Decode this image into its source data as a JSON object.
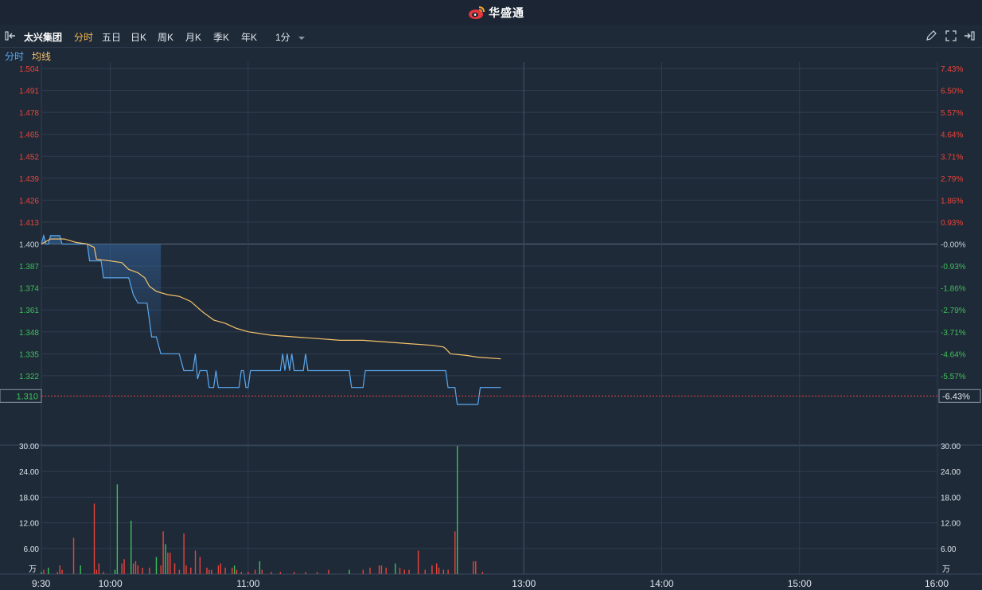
{
  "header": {
    "brand": "华盛通",
    "brand_color": "#e8383d"
  },
  "toolbar": {
    "stock_name": "太兴集团",
    "tabs": [
      "分时",
      "五日",
      "日K",
      "周K",
      "月K",
      "季K",
      "年K"
    ],
    "active_tab": "分时",
    "interval": "1分",
    "icons": [
      "draw-pen-icon",
      "fullscreen-icon",
      "collapse-right-icon"
    ]
  },
  "legend": {
    "price_label": "分时",
    "avg_label": "均线",
    "price_color": "#5aa9f0",
    "avg_color": "#f5c26b"
  },
  "colors": {
    "up": "#e8443a",
    "down": "#3dbf5a",
    "flat": "#c9d1dc",
    "bg": "#1f2a38",
    "grid": "#2e3d50"
  },
  "chart_data": {
    "type": "line",
    "base_price": 1.4,
    "price_ticks": [
      "1.504",
      "1.491",
      "1.478",
      "1.465",
      "1.452",
      "1.439",
      "1.426",
      "1.413",
      "1.400",
      "1.387",
      "1.374",
      "1.361",
      "1.348",
      "1.335",
      "1.322"
    ],
    "pct_ticks": [
      "7.43%",
      "6.50%",
      "5.57%",
      "4.64%",
      "3.71%",
      "2.79%",
      "1.86%",
      "0.93%",
      "-0.00%",
      "-0.93%",
      "-1.86%",
      "-2.79%",
      "-3.71%",
      "-4.64%",
      "-5.57%"
    ],
    "current_price": "1.310",
    "current_pct": "-6.43%",
    "ylim": [
      1.296,
      1.504
    ],
    "time_labels": [
      "9:30",
      "10:00",
      "11:00",
      "13:00",
      "14:00",
      "15:00",
      "16:00"
    ],
    "volume": {
      "unit": "万",
      "ticks": [
        "30.00",
        "24.00",
        "18.00",
        "12.00",
        "6.00"
      ],
      "ylim": [
        0,
        30
      ]
    },
    "series": [
      {
        "name": "分时",
        "points": [
          [
            0,
            1.4
          ],
          [
            1,
            1.405
          ],
          [
            2,
            1.4
          ],
          [
            3,
            1.4
          ],
          [
            4,
            1.405
          ],
          [
            5,
            1.405
          ],
          [
            6,
            1.405
          ],
          [
            8,
            1.405
          ],
          [
            9,
            1.4
          ],
          [
            13,
            1.4
          ],
          [
            20,
            1.4
          ],
          [
            21,
            1.39
          ],
          [
            26,
            1.39
          ],
          [
            27,
            1.38
          ],
          [
            38,
            1.38
          ],
          [
            40,
            1.37
          ],
          [
            42,
            1.365
          ],
          [
            46,
            1.365
          ],
          [
            48,
            1.345
          ],
          [
            50,
            1.345
          ],
          [
            52,
            1.335
          ],
          [
            60,
            1.335
          ],
          [
            62,
            1.325
          ],
          [
            66,
            1.325
          ],
          [
            67,
            1.335
          ],
          [
            68,
            1.32
          ],
          [
            69,
            1.325
          ],
          [
            72,
            1.325
          ],
          [
            73,
            1.315
          ],
          [
            75,
            1.315
          ],
          [
            76,
            1.325
          ],
          [
            77,
            1.315
          ],
          [
            86,
            1.315
          ],
          [
            87,
            1.325
          ],
          [
            88,
            1.325
          ],
          [
            89,
            1.315
          ],
          [
            90,
            1.315
          ],
          [
            91,
            1.325
          ],
          [
            104,
            1.325
          ],
          [
            105,
            1.335
          ],
          [
            106,
            1.325
          ],
          [
            107,
            1.335
          ],
          [
            108,
            1.325
          ],
          [
            109,
            1.335
          ],
          [
            110,
            1.325
          ],
          [
            114,
            1.325
          ],
          [
            115,
            1.335
          ],
          [
            116,
            1.325
          ],
          [
            134,
            1.325
          ],
          [
            135,
            1.315
          ],
          [
            140,
            1.315
          ],
          [
            141,
            1.325
          ],
          [
            176,
            1.325
          ],
          [
            177,
            1.315
          ],
          [
            180,
            1.315
          ],
          [
            181,
            1.305
          ],
          [
            183,
            1.305
          ],
          [
            185,
            1.305
          ],
          [
            190,
            1.305
          ],
          [
            191,
            1.315
          ],
          [
            200,
            1.315
          ]
        ]
      },
      {
        "name": "均线",
        "points": [
          [
            0,
            1.4
          ],
          [
            4,
            1.403
          ],
          [
            10,
            1.403
          ],
          [
            15,
            1.401
          ],
          [
            20,
            1.4
          ],
          [
            23,
            1.398
          ],
          [
            24,
            1.391
          ],
          [
            30,
            1.39
          ],
          [
            35,
            1.389
          ],
          [
            38,
            1.385
          ],
          [
            42,
            1.383
          ],
          [
            45,
            1.38
          ],
          [
            47,
            1.375
          ],
          [
            50,
            1.372
          ],
          [
            55,
            1.37
          ],
          [
            60,
            1.369
          ],
          [
            65,
            1.366
          ],
          [
            70,
            1.36
          ],
          [
            75,
            1.355
          ],
          [
            80,
            1.353
          ],
          [
            85,
            1.35
          ],
          [
            90,
            1.348
          ],
          [
            100,
            1.346
          ],
          [
            110,
            1.345
          ],
          [
            120,
            1.344
          ],
          [
            130,
            1.343
          ],
          [
            140,
            1.343
          ],
          [
            150,
            1.342
          ],
          [
            160,
            1.341
          ],
          [
            170,
            1.34
          ],
          [
            175,
            1.339
          ],
          [
            176,
            1.338
          ],
          [
            178,
            1.335
          ],
          [
            185,
            1.334
          ],
          [
            190,
            1.333
          ],
          [
            200,
            1.332
          ]
        ]
      }
    ],
    "volume_bars": [
      [
        0,
        0.5,
        "down"
      ],
      [
        1,
        1.0,
        "up"
      ],
      [
        3,
        1.5,
        "down"
      ],
      [
        7,
        0.5,
        "up"
      ],
      [
        8,
        2.0,
        "up"
      ],
      [
        9,
        1.0,
        "up"
      ],
      [
        14,
        8.5,
        "up"
      ],
      [
        17,
        2.0,
        "down"
      ],
      [
        23,
        16.5,
        "up"
      ],
      [
        24,
        1.0,
        "up"
      ],
      [
        25,
        2.5,
        "up"
      ],
      [
        27,
        0.5,
        "up"
      ],
      [
        32,
        1.0,
        "down"
      ],
      [
        33,
        21.0,
        "down"
      ],
      [
        35,
        2.5,
        "up"
      ],
      [
        36,
        3.5,
        "up"
      ],
      [
        39,
        12.5,
        "down"
      ],
      [
        40,
        2.5,
        "up"
      ],
      [
        41,
        3.0,
        "up"
      ],
      [
        42,
        2.0,
        "up"
      ],
      [
        44,
        1.5,
        "up"
      ],
      [
        47,
        1.5,
        "up"
      ],
      [
        50,
        4.0,
        "down"
      ],
      [
        52,
        2.0,
        "up"
      ],
      [
        53,
        10.0,
        "up"
      ],
      [
        54,
        7.0,
        "down"
      ],
      [
        55,
        5.0,
        "up"
      ],
      [
        56,
        5.0,
        "up"
      ],
      [
        58,
        2.5,
        "up"
      ],
      [
        60,
        1.0,
        "up"
      ],
      [
        62,
        9.5,
        "up"
      ],
      [
        63,
        2.0,
        "up"
      ],
      [
        65,
        1.5,
        "up"
      ],
      [
        67,
        5.5,
        "up"
      ],
      [
        69,
        4.0,
        "up"
      ],
      [
        72,
        1.5,
        "up"
      ],
      [
        73,
        1.0,
        "up"
      ],
      [
        74,
        1.0,
        "up"
      ],
      [
        77,
        2.0,
        "up"
      ],
      [
        78,
        2.5,
        "up"
      ],
      [
        80,
        1.5,
        "up"
      ],
      [
        83,
        1.5,
        "up"
      ],
      [
        84,
        2.0,
        "down"
      ],
      [
        85,
        1.0,
        "up"
      ],
      [
        87,
        0.5,
        "up"
      ],
      [
        90,
        0.5,
        "up"
      ],
      [
        93,
        1.0,
        "up"
      ],
      [
        95,
        3.0,
        "down"
      ],
      [
        96,
        1.0,
        "up"
      ],
      [
        100,
        0.5,
        "up"
      ],
      [
        104,
        0.5,
        "up"
      ],
      [
        110,
        0.5,
        "up"
      ],
      [
        115,
        0.5,
        "up"
      ],
      [
        120,
        0.5,
        "up"
      ],
      [
        125,
        1.0,
        "up"
      ],
      [
        134,
        1.0,
        "down"
      ],
      [
        140,
        1.0,
        "up"
      ],
      [
        143,
        1.5,
        "up"
      ],
      [
        147,
        2.0,
        "up"
      ],
      [
        148,
        2.0,
        "up"
      ],
      [
        150,
        1.5,
        "up"
      ],
      [
        154,
        2.5,
        "down"
      ],
      [
        156,
        1.5,
        "up"
      ],
      [
        158,
        1.0,
        "up"
      ],
      [
        160,
        1.0,
        "up"
      ],
      [
        164,
        5.5,
        "up"
      ],
      [
        167,
        1.0,
        "up"
      ],
      [
        170,
        2.0,
        "up"
      ],
      [
        172,
        2.5,
        "up"
      ],
      [
        173,
        1.5,
        "up"
      ],
      [
        175,
        1.0,
        "up"
      ],
      [
        177,
        1.0,
        "up"
      ],
      [
        180,
        10.0,
        "up"
      ],
      [
        181,
        30.0,
        "down"
      ],
      [
        188,
        3.0,
        "up"
      ],
      [
        189,
        3.0,
        "up"
      ],
      [
        192,
        0.5,
        "up"
      ]
    ]
  }
}
